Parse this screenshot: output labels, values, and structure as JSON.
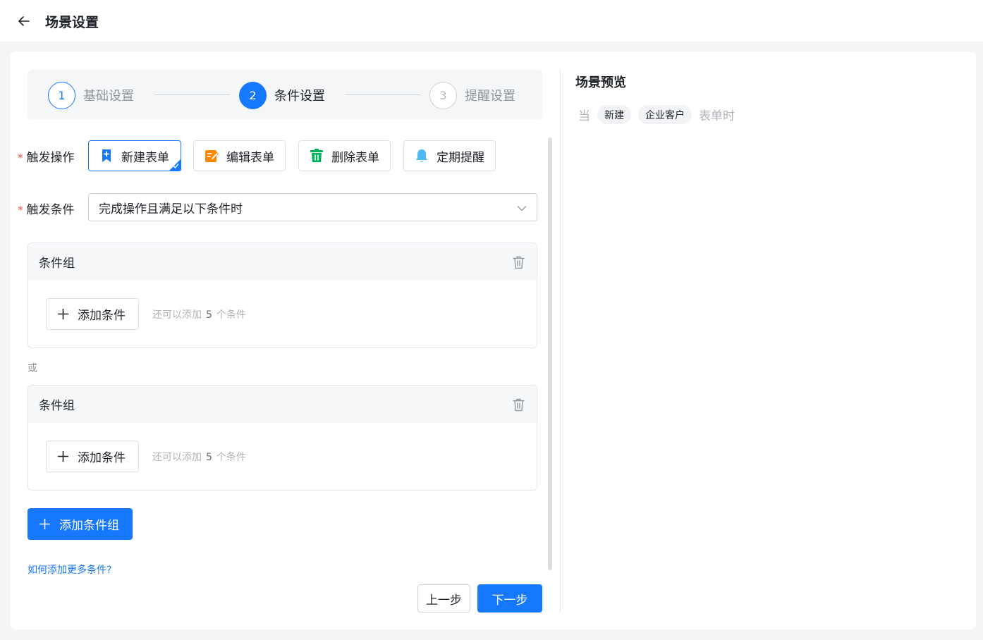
{
  "header": {
    "title": "场景设置"
  },
  "steps": [
    {
      "num": "1",
      "label": "基础设置"
    },
    {
      "num": "2",
      "label": "条件设置"
    },
    {
      "num": "3",
      "label": "提醒设置"
    }
  ],
  "form": {
    "trigger_action_label": "触发操作",
    "trigger_condition_label": "触发条件",
    "required_mark": "*",
    "actions": [
      {
        "label": "新建表单",
        "icon": "new-form-icon",
        "color": "#1677ff"
      },
      {
        "label": "编辑表单",
        "icon": "edit-form-icon",
        "color": "#ff8800"
      },
      {
        "label": "删除表单",
        "icon": "delete-form-icon",
        "color": "#00b259"
      },
      {
        "label": "定期提醒",
        "icon": "bell-icon",
        "color": "#4fb8f5"
      }
    ],
    "condition_value": "完成操作且满足以下条件时"
  },
  "groups": [
    {
      "title": "条件组",
      "add_label": "添加条件",
      "hint_prefix": "还可以添加",
      "hint_count": "5",
      "hint_suffix": "个条件"
    },
    {
      "title": "条件组",
      "add_label": "添加条件",
      "hint_prefix": "还可以添加",
      "hint_count": "5",
      "hint_suffix": "个条件"
    }
  ],
  "or_text": "或",
  "add_group_label": "添加条件组",
  "help_link": "如何添加更多条件?",
  "footer": {
    "prev_label": "上一步",
    "next_label": "下一步"
  },
  "preview": {
    "title": "场景预览",
    "prefix": "当",
    "tags": [
      "新建",
      "企业客户"
    ],
    "suffix": "表单时"
  },
  "colors": {
    "primary": "#1677ff",
    "required": "#f54a45"
  }
}
